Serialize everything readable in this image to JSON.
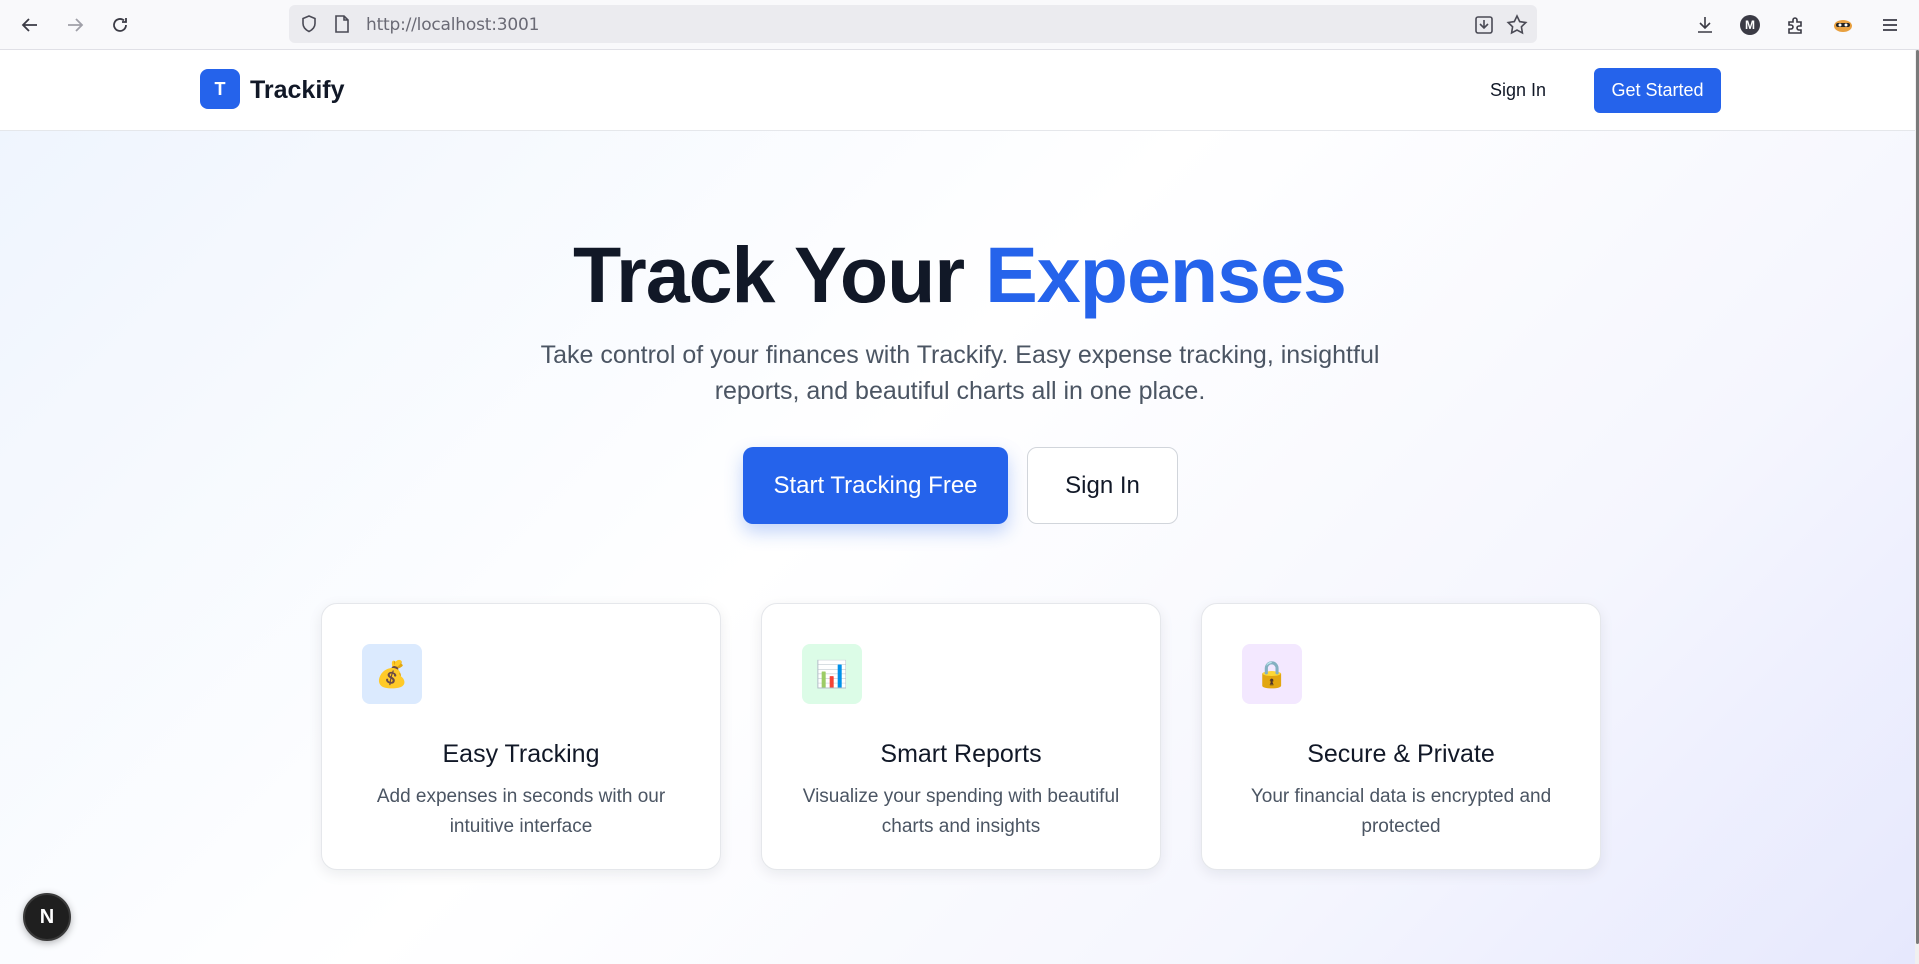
{
  "browser": {
    "url_host": "http://localhost",
    "url_port": ":3001",
    "profile_initial": "M"
  },
  "header": {
    "logo_letter": "T",
    "brand": "Trackify",
    "signin_label": "Sign In",
    "cta_label": "Get Started"
  },
  "hero": {
    "title_main": "Track Your ",
    "title_accent": "Expenses",
    "subtitle": "Take control of your finances with Trackify. Easy expense tracking, insightful reports, and beautiful charts all in one place.",
    "primary_label": "Start Tracking Free",
    "secondary_label": "Sign In"
  },
  "features": [
    {
      "icon": "money-bag-icon",
      "glyph": "💰",
      "bg": "#dbeafe",
      "title": "Easy Tracking",
      "desc": "Add expenses in seconds with our intuitive interface"
    },
    {
      "icon": "bar-chart-icon",
      "glyph": "📊",
      "bg": "#dcfce7",
      "title": "Smart Reports",
      "desc": "Visualize your spending with beautiful charts and insights"
    },
    {
      "icon": "lock-icon",
      "glyph": "🔒",
      "bg": "#f3e8ff",
      "title": "Secure & Private",
      "desc": "Your financial data is encrypted and protected"
    }
  ],
  "dev_badge": "N",
  "colors": {
    "brand": "#2563eb",
    "text": "#111827",
    "muted": "#4b5563"
  }
}
